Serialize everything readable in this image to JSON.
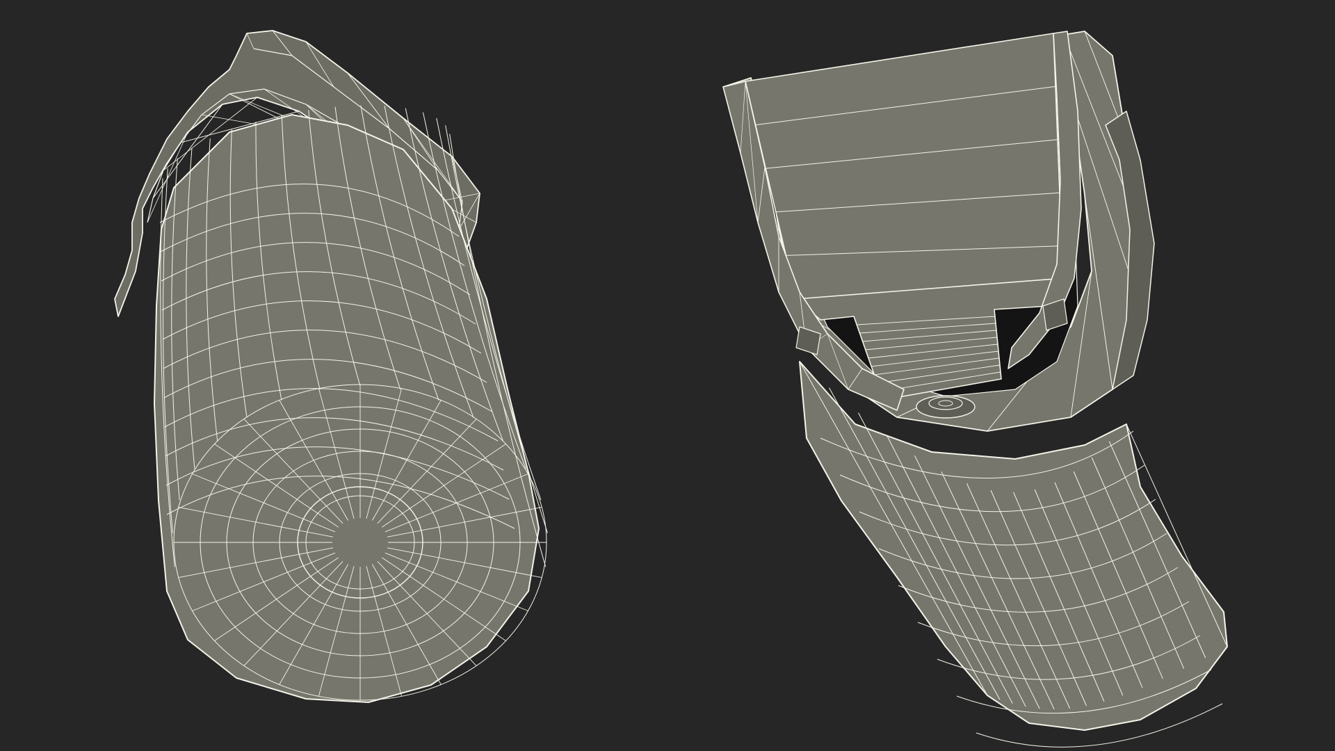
{
  "scene": {
    "background_color": "#262626",
    "mesh_fill_color": "#76766c",
    "mesh_shade_color": "#5e5e56",
    "wire_color": "#f4f4ea",
    "interior_color": "#141414",
    "views": [
      {
        "name": "bottom-view",
        "shape": "cylinder-bottle-with-clip"
      },
      {
        "name": "top-view",
        "shape": "cylinder-bottle-open-holder"
      }
    ]
  }
}
